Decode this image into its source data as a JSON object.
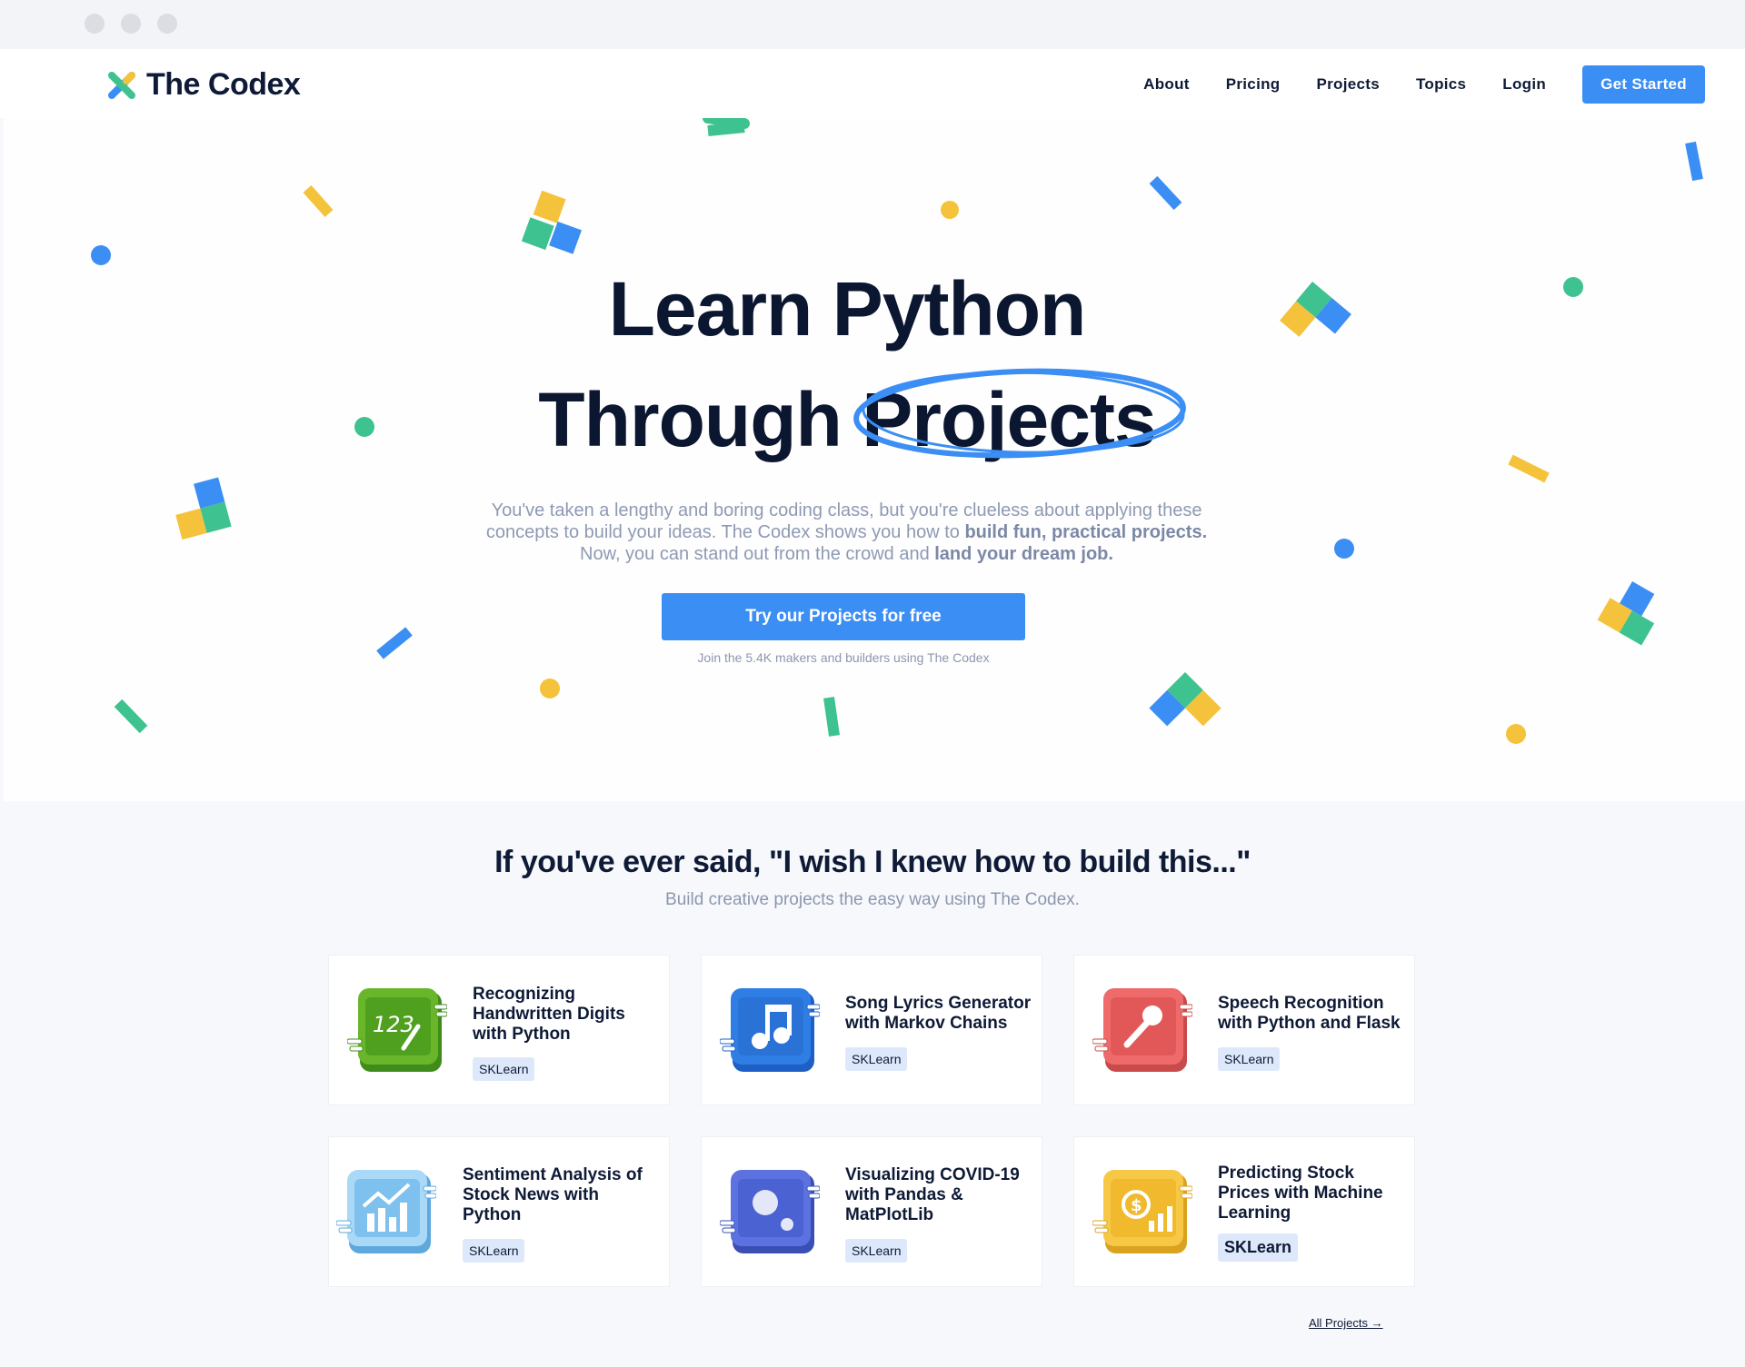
{
  "brand": {
    "name": "The Codex"
  },
  "nav": {
    "items": [
      "About",
      "Pricing",
      "Projects",
      "Topics",
      "Login"
    ],
    "cta": "Get Started"
  },
  "hero": {
    "title_line1": "Learn Python",
    "title_line2_a": "Through ",
    "title_line2_b": "Projects",
    "subtitle_1": "You've taken a lengthy and boring coding class, but you're clueless about applying these concepts to build your ideas. The Codex shows you how to ",
    "subtitle_bold_1": "build fun, practical projects.",
    "subtitle_2": " Now, you can stand out from the crowd and ",
    "subtitle_bold_2": "land your dream job.",
    "button": "Try our Projects for free",
    "note": "Join the 5.4K makers and builders using The Codex"
  },
  "projects": {
    "heading": "If you've ever said, \"I wish I knew how to build this...\"",
    "subheading": "Build creative projects the easy way using The Codex.",
    "cards": [
      {
        "title": "Recognizing Handwritten Digits with Python",
        "badge": "SKLearn",
        "icon": "handwritten-digits-icon"
      },
      {
        "title": "Song Lyrics Generator with Markov Chains",
        "badge": "SKLearn",
        "icon": "music-note-icon"
      },
      {
        "title": "Speech Recognition with Python and Flask",
        "badge": "SKLearn",
        "icon": "microphone-icon"
      },
      {
        "title": "Sentiment Analysis of Stock News with Python",
        "badge": "SKLearn",
        "icon": "stock-chart-icon"
      },
      {
        "title": "Visualizing COVID-19 with Pandas & MatPlotLib",
        "badge": "SKLearn",
        "icon": "virus-icon"
      },
      {
        "title": "Predicting Stock Prices with Machine Learning",
        "badge": "SKLearn",
        "icon": "dollar-growth-icon"
      }
    ],
    "all_link": "All Projects →"
  },
  "colors": {
    "accent": "#3b8ef3",
    "green": "#3ec28f",
    "yellow": "#f5c33b",
    "blue": "#3b8ef3",
    "red": "#ef6b6b"
  }
}
